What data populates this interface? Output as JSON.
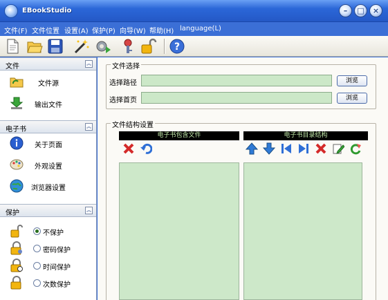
{
  "window": {
    "title": "EBookStudio"
  },
  "menu": [
    "文件(F)",
    "文件位置",
    "设置(A)",
    "保护(P)",
    "向导(W)",
    "帮助(H)",
    "language(L)"
  ],
  "toolbar": [
    "new-file-icon",
    "open-folder-icon",
    "save-icon",
    "magic-wand-icon",
    "gear-play-icon",
    "key-icon",
    "lock-icon",
    "help-icon"
  ],
  "sidebar": {
    "file": {
      "title": "文件",
      "items": [
        "文件源",
        "输出文件"
      ]
    },
    "ebook": {
      "title": "电子书",
      "items": [
        "关于页面",
        "外观设置",
        "浏览器设置"
      ]
    },
    "protect": {
      "title": "保护",
      "options": [
        "不保护",
        "密码保护",
        "时间保护",
        "次数保护"
      ],
      "selected": 0
    }
  },
  "file_select": {
    "title": "文件选择",
    "path_label": "选择路径",
    "home_label": "选择首页",
    "path_value": "",
    "home_value": "",
    "browse": "浏览"
  },
  "structure": {
    "title": "文件结构设置",
    "left_header": "电子书包含文件",
    "right_header": "电子书目录结构"
  },
  "colors": {
    "field": "#cce8c8",
    "titlebar": "#2b67d8"
  }
}
